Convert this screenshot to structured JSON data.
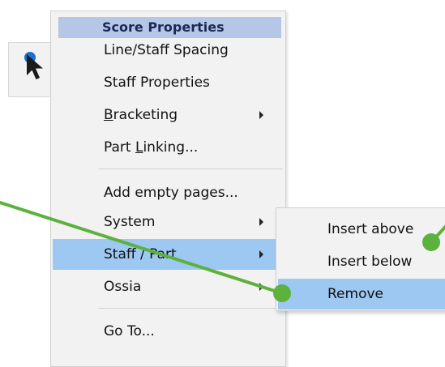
{
  "toolbar": {
    "tool_icon": "selection-arrow-icon"
  },
  "context_menu": {
    "header": "Score Properties",
    "items": [
      {
        "before": "",
        "mnemonic": "",
        "after": "Line/Staff Spacing",
        "submenu": false
      },
      {
        "before": "",
        "mnemonic": "",
        "after": "Staff Properties",
        "submenu": false
      },
      {
        "before": "",
        "mnemonic": "B",
        "after": "racketing",
        "submenu": true
      },
      {
        "before": "Part ",
        "mnemonic": "L",
        "after": "inking...",
        "submenu": false
      },
      {
        "before": "",
        "mnemonic": "",
        "after": "Add empty pages...",
        "submenu": false
      },
      {
        "before": "",
        "mnemonic": "",
        "after": "System",
        "submenu": true
      },
      {
        "before": "",
        "mnemonic": "",
        "after": "Staff / Part",
        "submenu": true
      },
      {
        "before": "",
        "mnemonic": "",
        "after": "Ossia",
        "submenu": true
      },
      {
        "before": "",
        "mnemonic": "",
        "after": "Go To...",
        "submenu": false
      }
    ],
    "highlighted_item": "Staff / Part"
  },
  "submenu": {
    "items": [
      "Insert above",
      "Insert below",
      "Remove"
    ],
    "highlighted_item": "Remove"
  },
  "annotation": {
    "line_color": "#5cb23c",
    "dot_color": "#5cb23c"
  },
  "colors": {
    "menu_background": "#f2f2f2",
    "highlight": "#9dc8f2",
    "header_background": "#b5c6e6",
    "header_text": "#1a2a57"
  }
}
